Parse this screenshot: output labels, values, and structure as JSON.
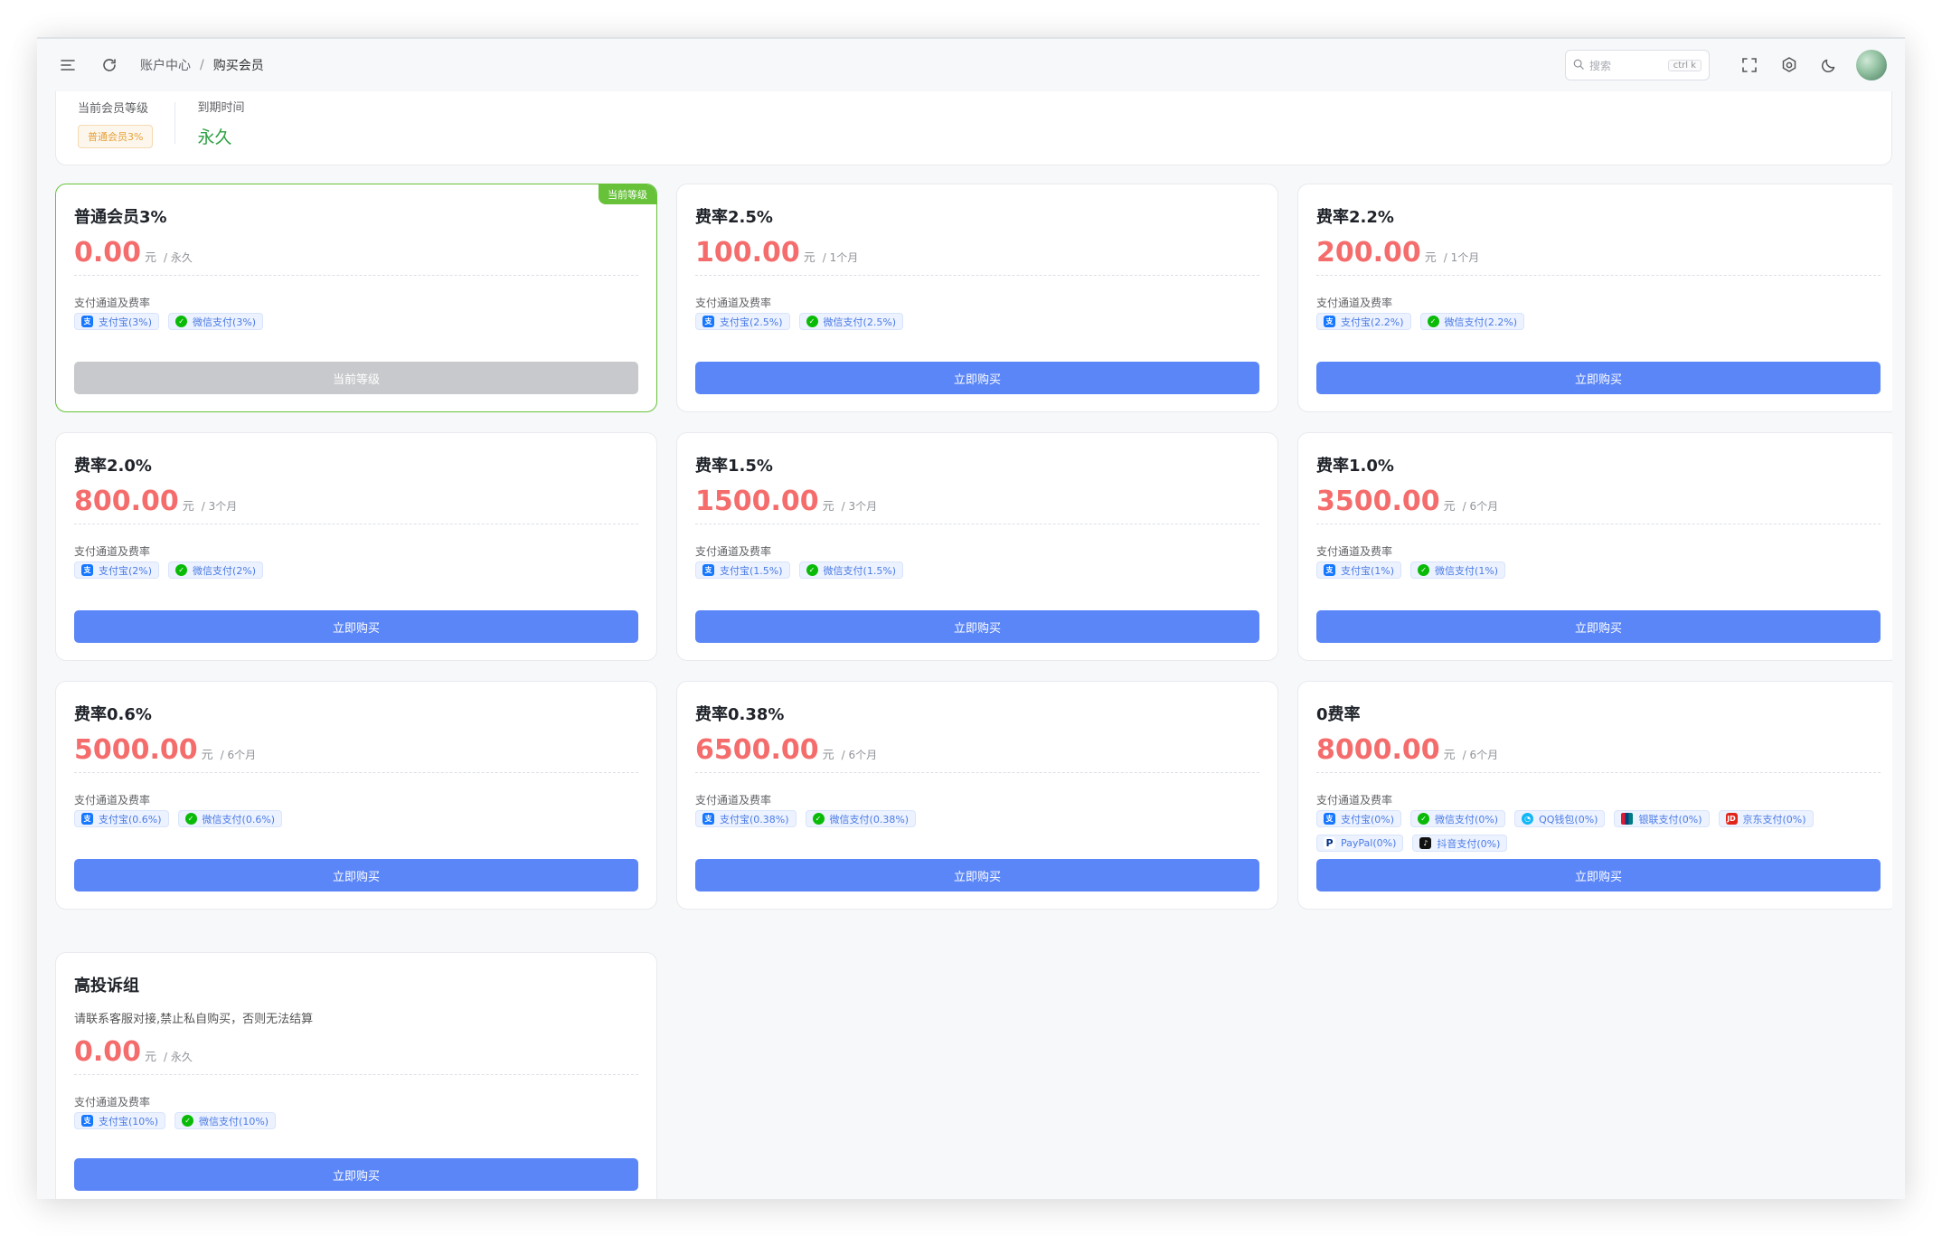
{
  "header": {
    "breadcrumb": [
      "账户中心",
      "购买会员"
    ],
    "breadcrumb_sep": "/",
    "search_placeholder": "搜索",
    "search_shortcut": "ctrl k"
  },
  "summary": {
    "level_label": "当前会员等级",
    "level_value": "普通会员3%",
    "expiry_label": "到期时间",
    "expiry_value": "永久"
  },
  "common": {
    "unit": "元",
    "channels_label": "支付通道及费率",
    "buy_label": "立即购买",
    "current_label": "当前等级",
    "corner_label": "当前等级"
  },
  "plans": [
    {
      "name": "普通会员3%",
      "price": "0.00",
      "period": "/ 永久",
      "current": true,
      "channels": [
        {
          "icon": "alipay",
          "label": "支付宝(3%)"
        },
        {
          "icon": "wechat",
          "label": "微信支付(3%)"
        }
      ]
    },
    {
      "name": "费率2.5%",
      "price": "100.00",
      "period": "/ 1个月",
      "channels": [
        {
          "icon": "alipay",
          "label": "支付宝(2.5%)"
        },
        {
          "icon": "wechat",
          "label": "微信支付(2.5%)"
        }
      ]
    },
    {
      "name": "费率2.2%",
      "price": "200.00",
      "period": "/ 1个月",
      "channels": [
        {
          "icon": "alipay",
          "label": "支付宝(2.2%)"
        },
        {
          "icon": "wechat",
          "label": "微信支付(2.2%)"
        }
      ]
    },
    {
      "name": "费率2.0%",
      "price": "800.00",
      "period": "/ 3个月",
      "channels": [
        {
          "icon": "alipay",
          "label": "支付宝(2%)"
        },
        {
          "icon": "wechat",
          "label": "微信支付(2%)"
        }
      ]
    },
    {
      "name": "费率1.5%",
      "price": "1500.00",
      "period": "/ 3个月",
      "channels": [
        {
          "icon": "alipay",
          "label": "支付宝(1.5%)"
        },
        {
          "icon": "wechat",
          "label": "微信支付(1.5%)"
        }
      ]
    },
    {
      "name": "费率1.0%",
      "price": "3500.00",
      "period": "/ 6个月",
      "channels": [
        {
          "icon": "alipay",
          "label": "支付宝(1%)"
        },
        {
          "icon": "wechat",
          "label": "微信支付(1%)"
        }
      ]
    },
    {
      "name": "费率0.6%",
      "price": "5000.00",
      "period": "/ 6个月",
      "channels": [
        {
          "icon": "alipay",
          "label": "支付宝(0.6%)"
        },
        {
          "icon": "wechat",
          "label": "微信支付(0.6%)"
        }
      ]
    },
    {
      "name": "费率0.38%",
      "price": "6500.00",
      "period": "/ 6个月",
      "channels": [
        {
          "icon": "alipay",
          "label": "支付宝(0.38%)"
        },
        {
          "icon": "wechat",
          "label": "微信支付(0.38%)"
        }
      ]
    },
    {
      "name": "0费率",
      "price": "8000.00",
      "period": "/ 6个月",
      "channels": [
        {
          "icon": "alipay",
          "label": "支付宝(0%)"
        },
        {
          "icon": "wechat",
          "label": "微信支付(0%)"
        },
        {
          "icon": "qq",
          "label": "QQ钱包(0%)"
        },
        {
          "icon": "unionpay",
          "label": "银联支付(0%)"
        },
        {
          "icon": "jd",
          "label": "京东支付(0%)"
        },
        {
          "icon": "paypal",
          "label": "PayPal(0%)"
        },
        {
          "icon": "douyin",
          "label": "抖音支付(0%)"
        }
      ]
    },
    {
      "name": "高投诉组",
      "desc": "请联系客服对接,禁止私自购买，否则无法结算",
      "price": "0.00",
      "period": "/ 永久",
      "channels": [
        {
          "icon": "alipay",
          "label": "支付宝(10%)"
        },
        {
          "icon": "wechat",
          "label": "微信支付(10%)"
        }
      ]
    }
  ],
  "colors": {
    "price": "#f56c6c",
    "button": "#5b86f7",
    "active_border": "#67c23a",
    "expiry": "#2ea043"
  }
}
